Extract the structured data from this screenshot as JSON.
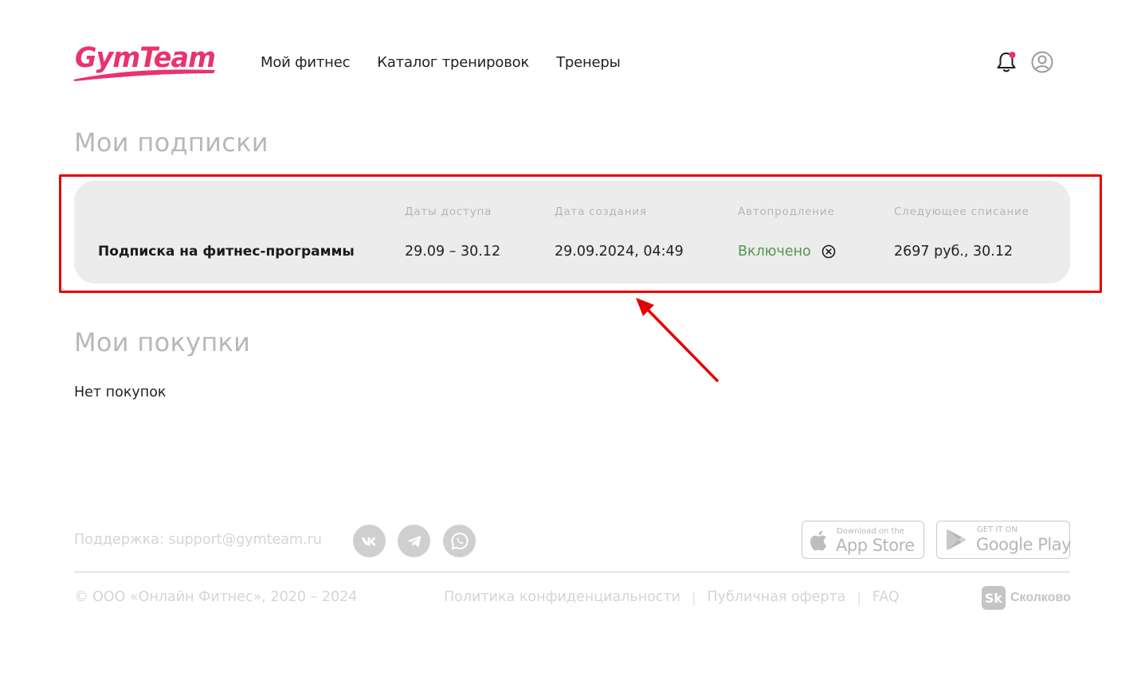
{
  "header": {
    "logo_text": "GymTeam",
    "nav": [
      {
        "label": "Мой фитнес"
      },
      {
        "label": "Каталог тренировок"
      },
      {
        "label": "Тренеры"
      }
    ],
    "icons": {
      "notifications": "bell-icon",
      "profile": "user-circle-icon"
    }
  },
  "subscriptions": {
    "title": "Мои подписки",
    "columns": {
      "access_dates": "Даты доступа",
      "created": "Дата создания",
      "autorenew": "Автопродление",
      "next_charge": "Следующее списание"
    },
    "items": [
      {
        "name": "Подписка на фитнес-программы",
        "access_dates": "29.09 – 30.12",
        "created": "29.09.2024, 04:49",
        "autorenew": "Включено",
        "next_charge": "2697 руб., 30.12"
      }
    ]
  },
  "purchases": {
    "title": "Мои покупки",
    "empty": "Нет покупок"
  },
  "footer": {
    "support": "Поддержка: support@gymteam.ru",
    "social": [
      "vk-icon",
      "telegram-icon",
      "whatsapp-icon"
    ],
    "app_store": {
      "small": "Download on the",
      "big": "App Store"
    },
    "google_play": {
      "small": "GET IT ON",
      "big": "Google Play"
    },
    "copyright": "© ООО «Онлайн Фитнес», 2020 – 2024",
    "links": [
      "Политика конфиденциальности",
      "Публичная оферта",
      "FAQ"
    ],
    "partner": {
      "badge": "Sk",
      "name": "Сколково"
    }
  },
  "colors": {
    "brand": "#e8336d",
    "status_on": "#4f9a4a",
    "annotation": "#e60000",
    "card_bg": "#ececec"
  }
}
